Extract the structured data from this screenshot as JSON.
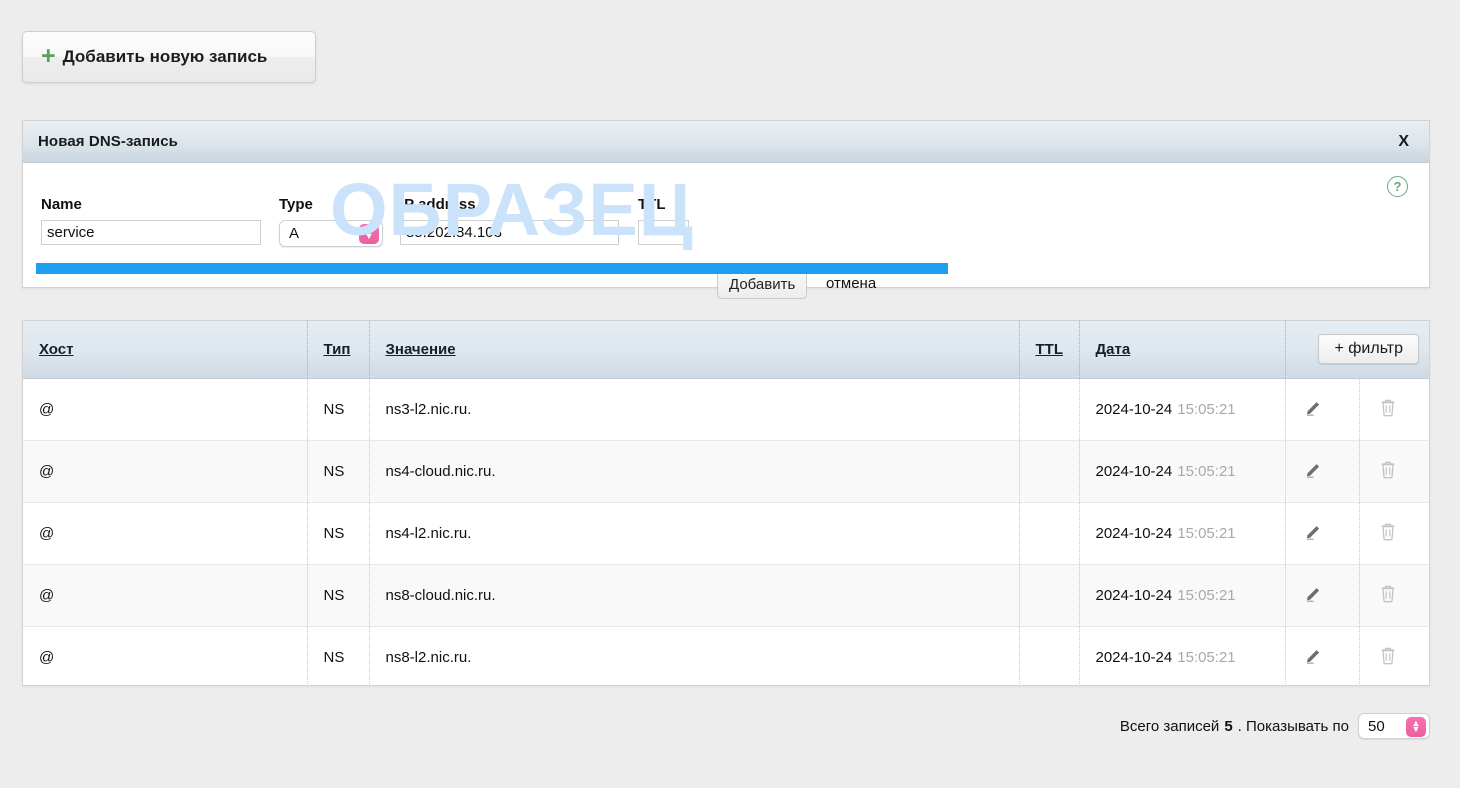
{
  "toolbar": {
    "add_record_label": "Добавить новую запись",
    "plus_icon": "plus-icon"
  },
  "panel": {
    "title": "Новая DNS-запись",
    "close_label": "X",
    "help_label": "?",
    "watermark": "ОБРАЗЕЦ",
    "fields": {
      "name": {
        "label": "Name",
        "value": "service"
      },
      "type": {
        "label": "Type",
        "value": "A"
      },
      "ip": {
        "label": "IP address",
        "value": "85.202.84.103"
      },
      "ttl": {
        "label": "TTL",
        "value": ""
      }
    },
    "submit_label": "Добавить",
    "cancel_label": "отмена",
    "progress_color": "#1e9ef0"
  },
  "table": {
    "columns": {
      "host": "Хост",
      "type": "Тип",
      "value": "Значение",
      "ttl": "TTL",
      "date": "Дата"
    },
    "filter_label": "+ фильтр",
    "rows": [
      {
        "host": "@",
        "type": "NS",
        "value": "ns3-l2.nic.ru.",
        "ttl": "",
        "date": "2024-10-24",
        "time": "15:05:21"
      },
      {
        "host": "@",
        "type": "NS",
        "value": "ns4-cloud.nic.ru.",
        "ttl": "",
        "date": "2024-10-24",
        "time": "15:05:21"
      },
      {
        "host": "@",
        "type": "NS",
        "value": "ns4-l2.nic.ru.",
        "ttl": "",
        "date": "2024-10-24",
        "time": "15:05:21"
      },
      {
        "host": "@",
        "type": "NS",
        "value": "ns8-cloud.nic.ru.",
        "ttl": "",
        "date": "2024-10-24",
        "time": "15:05:21"
      },
      {
        "host": "@",
        "type": "NS",
        "value": "ns8-l2.nic.ru.",
        "ttl": "",
        "date": "2024-10-24",
        "time": "15:05:21"
      }
    ]
  },
  "footer": {
    "total_prefix": "Всего записей",
    "total_count": "5",
    "total_suffix": ". Показывать по",
    "per_page": "50"
  },
  "colors": {
    "accent_pink": "#ec5f9e",
    "progress_blue": "#1e9ef0",
    "watermark_blue": "#cbe3fa",
    "plus_green": "#5aa05a"
  }
}
